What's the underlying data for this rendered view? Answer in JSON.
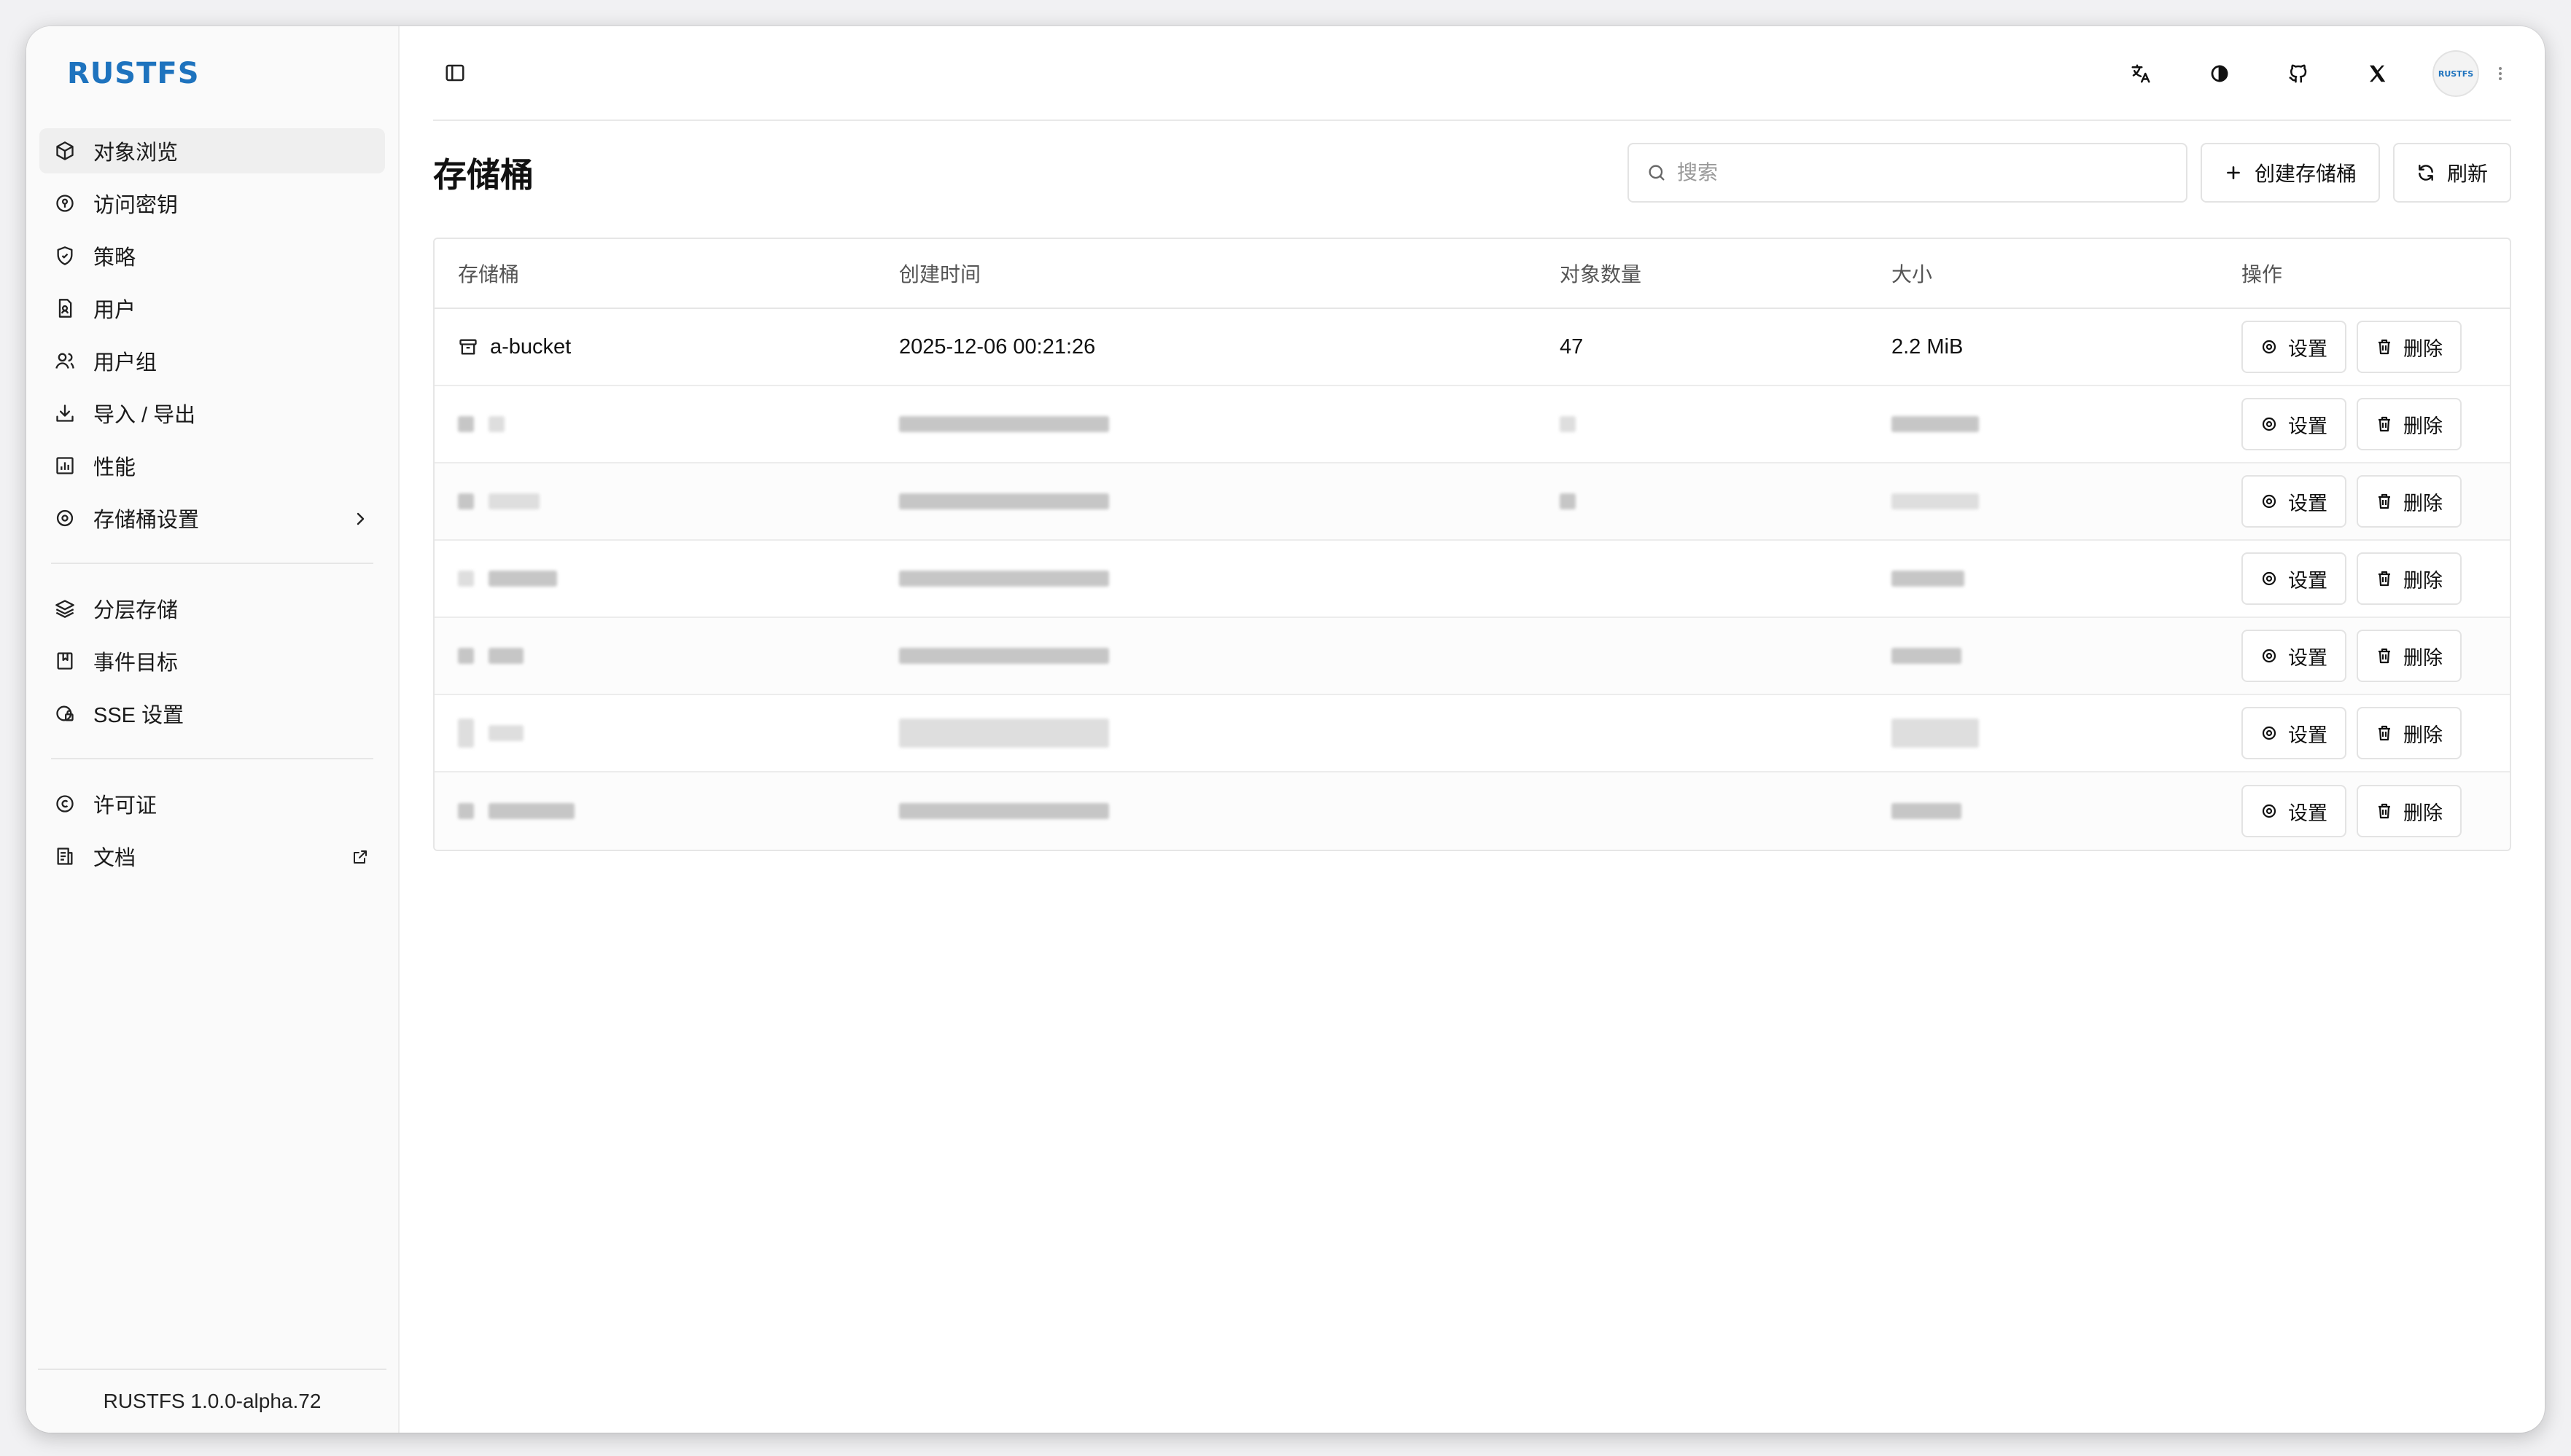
{
  "brand": {
    "logo_text": "RUSTFS",
    "color": "#1e73be"
  },
  "sidebar": {
    "items": [
      {
        "label": "对象浏览",
        "icon": "cube-icon",
        "active": true
      },
      {
        "label": "访问密钥",
        "icon": "key-circle-icon"
      },
      {
        "label": "策略",
        "icon": "shield-icon"
      },
      {
        "label": "用户",
        "icon": "user-file-icon"
      },
      {
        "label": "用户组",
        "icon": "users-icon"
      },
      {
        "label": "导入 / 导出",
        "icon": "download-icon"
      },
      {
        "label": "性能",
        "icon": "chart-icon"
      },
      {
        "label": "存储桶设置",
        "icon": "gear-icon",
        "trailing": "chevron-right-icon"
      },
      {
        "label": "分层存储",
        "icon": "layers-icon"
      },
      {
        "label": "事件目标",
        "icon": "bookmark-icon"
      },
      {
        "label": "SSE 设置",
        "icon": "lock-gear-icon"
      },
      {
        "label": "许可证",
        "icon": "copyright-icon"
      },
      {
        "label": "文档",
        "icon": "document-icon",
        "trailing": "external-link-icon"
      }
    ],
    "footer": "RUSTFS 1.0.0-alpha.72"
  },
  "topbar": {
    "icons": [
      "translate-icon",
      "theme-icon",
      "github-icon",
      "x-icon"
    ],
    "avatar_text": "RUSTFS"
  },
  "page": {
    "title": "存储桶",
    "search_placeholder": "搜索",
    "create_button": "创建存储桶",
    "refresh_button": "刷新"
  },
  "table": {
    "columns": [
      "存储桶",
      "创建时间",
      "对象数量",
      "大小",
      "操作"
    ],
    "rows": [
      {
        "name": "a-bucket",
        "created": "2025-12-06 00:21:26",
        "objects": "47",
        "size": "2.2 MiB"
      }
    ],
    "redacted_row_count": 6,
    "row_actions": {
      "settings": "设置",
      "delete": "删除"
    }
  }
}
